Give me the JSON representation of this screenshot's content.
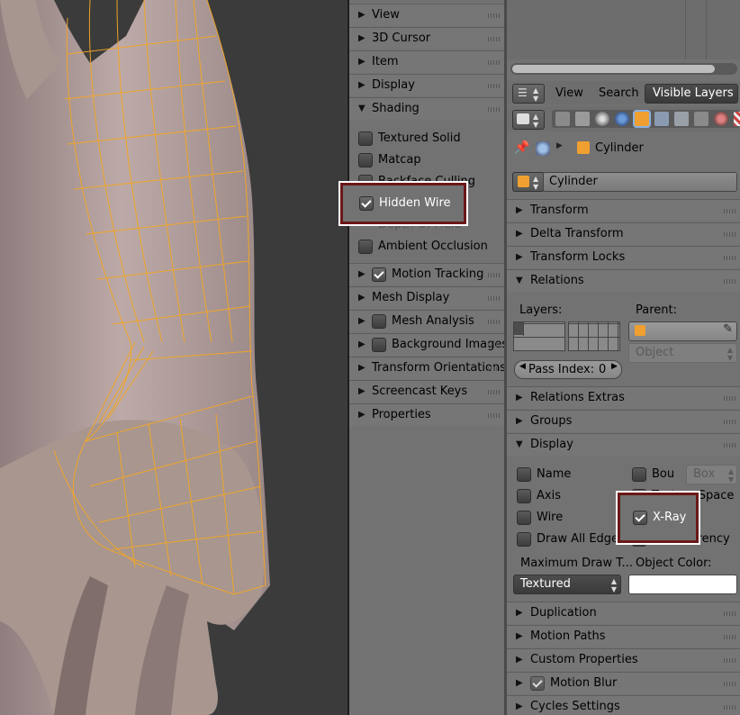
{
  "n_panel": {
    "headers": {
      "view": "View",
      "cursor": "3D Cursor",
      "item": "Item",
      "display": "Display",
      "shading": "Shading",
      "motion_tracking": "Motion Tracking",
      "mesh_display": "Mesh Display",
      "mesh_analysis": "Mesh Analysis",
      "background_images": "Background Images",
      "transform_orientations": "Transform Orientations",
      "screencast_keys": "Screencast Keys",
      "properties": "Properties"
    },
    "shading_options": {
      "textured_solid": "Textured Solid",
      "matcap": "Matcap",
      "backface_culling": "Backface Culling",
      "hidden_wire": "Hidden Wire",
      "depth_of_field": "Depth Of Field",
      "ambient_occlusion": "Ambient Occlusion"
    }
  },
  "outliner": {
    "view_menu": "View",
    "search_menu": "Search",
    "filter_value": "Visible Layers"
  },
  "properties": {
    "breadcrumb_object": "Cylinder",
    "object_name": "Cylinder",
    "panels": {
      "transform": "Transform",
      "delta_transform": "Delta Transform",
      "transform_locks": "Transform Locks",
      "relations": "Relations",
      "relations_extras": "Relations Extras",
      "groups": "Groups",
      "display": "Display",
      "duplication": "Duplication",
      "motion_paths": "Motion Paths",
      "custom_properties": "Custom Properties",
      "motion_blur": "Motion Blur",
      "cycles_settings": "Cycles Settings"
    },
    "relations": {
      "layers_label": "Layers:",
      "parent_label": "Parent:",
      "parent_type": "Object",
      "pass_index_label": "Pass Index:",
      "pass_index_value": "0"
    },
    "display": {
      "name": "Name",
      "axis": "Axis",
      "wire": "Wire",
      "draw_all_edges": "Draw All Edges",
      "bounds": "Bou",
      "bounds_type": "Box",
      "texture_space": "Texture Space",
      "x_ray": "X-Ray",
      "transparency": "Transparency",
      "max_draw_type_label": "Maximum Draw T...",
      "max_draw_type_value": "Textured",
      "object_color_label": "Object Color:",
      "object_color": "#ffffff"
    }
  },
  "colors": {
    "wire": "#f5a623",
    "highlight": "#6b1818",
    "panel_bg": "#727272"
  }
}
